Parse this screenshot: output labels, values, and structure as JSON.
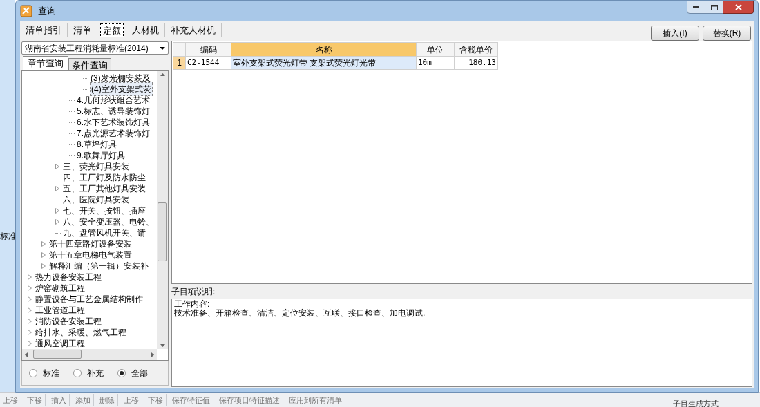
{
  "background_app": {
    "side_label": "标准",
    "toolbar": [
      "上移",
      "下移",
      "插入",
      "添加",
      "删除",
      "上移",
      "下移",
      "保存特征值",
      "保存项目特征描述",
      "应用到所有清单"
    ],
    "status_label": "子目生成方式"
  },
  "window": {
    "title": "查询"
  },
  "tabs": [
    {
      "label": "清单指引",
      "selected": false
    },
    {
      "label": "清单",
      "selected": false
    },
    {
      "label": "定额",
      "selected": true
    },
    {
      "label": "人材机",
      "selected": false
    },
    {
      "label": "补充人材机",
      "selected": false
    }
  ],
  "buttons": [
    "插入(I)",
    "替换(R)"
  ],
  "library": {
    "value": "湖南省安装工程消耗量标准(2014)"
  },
  "subtabs": [
    {
      "label": "章节查询",
      "selected": true
    },
    {
      "label": "条件查询",
      "selected": false
    }
  ],
  "tree": [
    {
      "children": [
        {
          "children": [
            {
              "children": [
                {
                  "children": [
                    {
                      "label": "(3)发光棚安装及",
                      "selected": false
                    },
                    {
                      "label": "(4)室外支架式荧",
                      "selected": true
                    }
                  ]
                },
                {
                  "label": "4.几何形状组合艺术",
                  "selected": false
                },
                {
                  "label": "5.标志、诱导装饰灯",
                  "selected": false
                },
                {
                  "label": "6.水下艺术装饰灯具",
                  "selected": false
                },
                {
                  "label": "7.点光源艺术装饰灯",
                  "selected": false
                },
                {
                  "label": "8.草坪灯具",
                  "selected": false
                },
                {
                  "label": "9.歌舞厅灯具",
                  "selected": false
                }
              ]
            },
            {
              "label": "三、荧光灯具安装",
              "selected": false,
              "expanded": false
            },
            {
              "label": "四、工厂灯及防水防尘",
              "selected": false
            },
            {
              "label": "五、工厂其他灯具安装",
              "selected": false,
              "expanded": false
            },
            {
              "label": "六、医院灯具安装",
              "selected": false
            },
            {
              "label": "七、开关、按钮、插座",
              "selected": false,
              "expanded": false
            },
            {
              "label": "八、安全变压器、电铃、",
              "selected": false,
              "expanded": false
            },
            {
              "label": "九、盘管风机开关、请",
              "selected": false
            }
          ]
        },
        {
          "label": "第十四章路灯设备安装",
          "selected": false,
          "expanded": false
        },
        {
          "label": "第十五章电梯电气装置",
          "selected": false,
          "expanded": false
        },
        {
          "label": "解释汇编（第一辑）安装补",
          "selected": false,
          "expanded": false
        }
      ]
    },
    {
      "label": "热力设备安装工程",
      "selected": false,
      "expanded": false
    },
    {
      "label": "炉窑砌筑工程",
      "selected": false,
      "expanded": false
    },
    {
      "label": "静置设备与工艺金属结构制作",
      "selected": false,
      "expanded": false
    },
    {
      "label": "工业管道工程",
      "selected": false,
      "expanded": false
    },
    {
      "label": "消防设备安装工程",
      "selected": false,
      "expanded": false
    },
    {
      "label": "给排水、采暖、燃气工程",
      "selected": false,
      "expanded": false
    },
    {
      "label": "通风空调工程",
      "selected": false,
      "expanded": false
    }
  ],
  "filter": [
    {
      "label": "标准",
      "selected": false
    },
    {
      "label": "补充",
      "selected": false
    },
    {
      "label": "全部",
      "selected": true
    }
  ],
  "table": {
    "columns": [
      {
        "label": "编码",
        "selected": false
      },
      {
        "label": "名称",
        "selected": true
      },
      {
        "label": "单位",
        "selected": false
      },
      {
        "label": "含税单价",
        "selected": false
      }
    ],
    "rows": [
      {
        "index": "1",
        "selected": true,
        "cells": [
          "C2-1544",
          "室外支架式荧光灯带 支架式荧光灯光带",
          "10m",
          "180.13"
        ]
      }
    ]
  },
  "description": {
    "label": "子目项说明:",
    "lines": [
      "工作内容:",
      "技术准备、开箱检查、清洁、定位安装、互联、接口检查、加电调试."
    ]
  }
}
